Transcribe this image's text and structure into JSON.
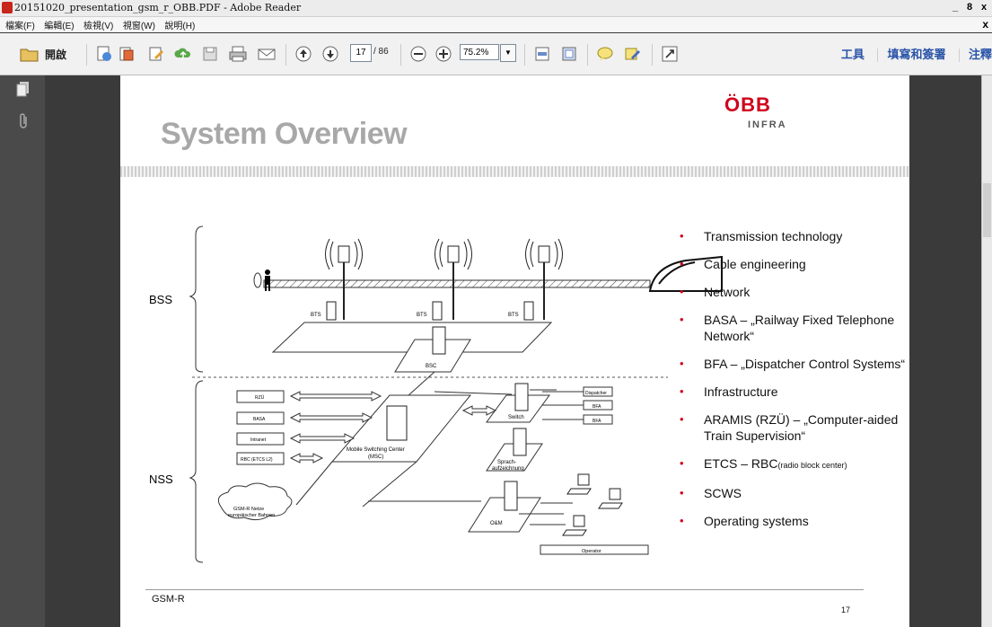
{
  "window": {
    "title": "20151020_presentation_gsm_r_OBB.PDF - Adobe Reader",
    "controls": [
      "_",
      "8",
      "x"
    ]
  },
  "menubar": {
    "items": [
      "檔案(F)",
      "編輯(E)",
      "檢視(V)",
      "視窗(W)",
      "說明(H)"
    ],
    "close": "x"
  },
  "toolbar": {
    "open_label": "開啟",
    "page_current": "17",
    "page_total": "/ 86",
    "zoom": "75.2%",
    "right_links": [
      "工具",
      "填寫和簽署",
      "注釋"
    ]
  },
  "slide": {
    "title": "System Overview",
    "logo_text": "ÖBB",
    "logo_sub": "INFRA",
    "bullets": [
      {
        "text": "Transmission technology"
      },
      {
        "text": "Cable engineering"
      },
      {
        "text": "Network"
      },
      {
        "text": "BASA – „Railway Fixed Telephone Network“"
      },
      {
        "text": "BFA – „Dispatcher Control Systems“"
      },
      {
        "text": "Infrastructure"
      },
      {
        "text": "ARAMIS  (RZÜ) – „Computer-aided Train Supervision“"
      },
      {
        "text": "ETCS – RBC",
        "small": "(radio block center)"
      },
      {
        "text": "SCWS"
      },
      {
        "text": "Operating systems"
      }
    ],
    "footer": "GSM-R",
    "page_number": "17",
    "diagram": {
      "bss": "BSS",
      "nss": "NSS",
      "bts": "BTS",
      "bsc": "BSC",
      "msc": "Mobile Switching Center (MSC)",
      "switch": "Switch",
      "sprach": "Sprach- aufzeichnung",
      "om": "O&M",
      "operator": "Operator",
      "left_boxes": [
        "RZÜ",
        "BASA",
        "Intranet",
        "RBC (ETCS L2)"
      ],
      "right_boxes": [
        "Dispatcher",
        "BFA",
        "BFA"
      ],
      "cloud": "GSM-R Netze europäischer Bahnen"
    }
  }
}
